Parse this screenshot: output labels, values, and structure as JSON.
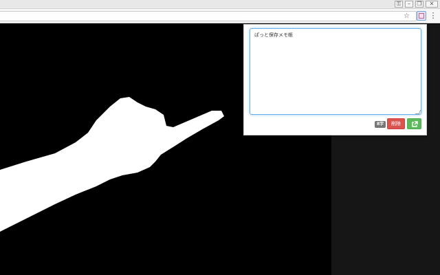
{
  "window": {
    "controls": [
      "lock-icon",
      "minimize-icon",
      "restore-icon",
      "close-icon"
    ],
    "control_glyphs": [
      "⚿",
      "–",
      "❐",
      "✕"
    ]
  },
  "toolbar": {
    "star_glyph": "☆",
    "menu_glyph": "⋮",
    "extension_icon": "memo-extension-icon"
  },
  "popup": {
    "memo_text": "ぱっと保存メモ帳",
    "char_count": "8字",
    "delete_label": "削除",
    "open_icon": "external-link-icon",
    "colors": {
      "focus_border": "#66afe9",
      "delete": "#d9534f",
      "open": "#5cb85c",
      "badge": "#777777"
    }
  }
}
